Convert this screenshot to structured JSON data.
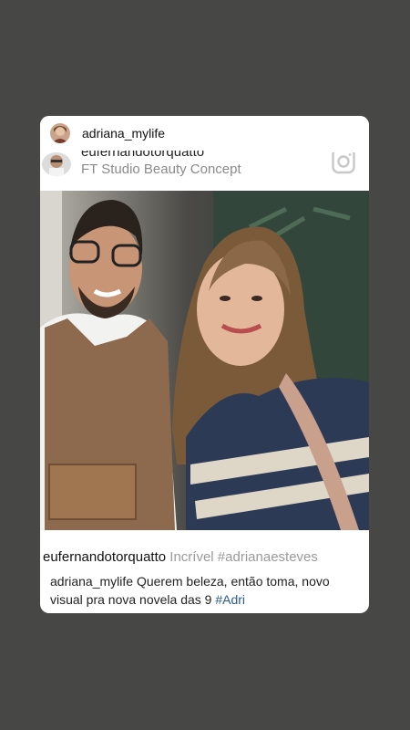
{
  "story": {
    "username": "adriana_mylife",
    "post": {
      "author": "eufernandotorquatto",
      "location": "FT Studio Beauty Concept",
      "caption_author": "eufernandotorquatto",
      "caption_text": "Incrível #adrianaesteves",
      "comment_author": "adriana_mylife",
      "comment_text": "Querem beleza, então toma, novo visual pra nova novela das 9",
      "comment_tag": "#Adri"
    }
  },
  "colors": {
    "background": "#474845",
    "card": "#ffffff",
    "hashtag": "#2b5a8a"
  },
  "icons": {
    "story_avatar": "profile-avatar",
    "post_avatar": "profile-avatar",
    "platform": "instagram-icon"
  }
}
